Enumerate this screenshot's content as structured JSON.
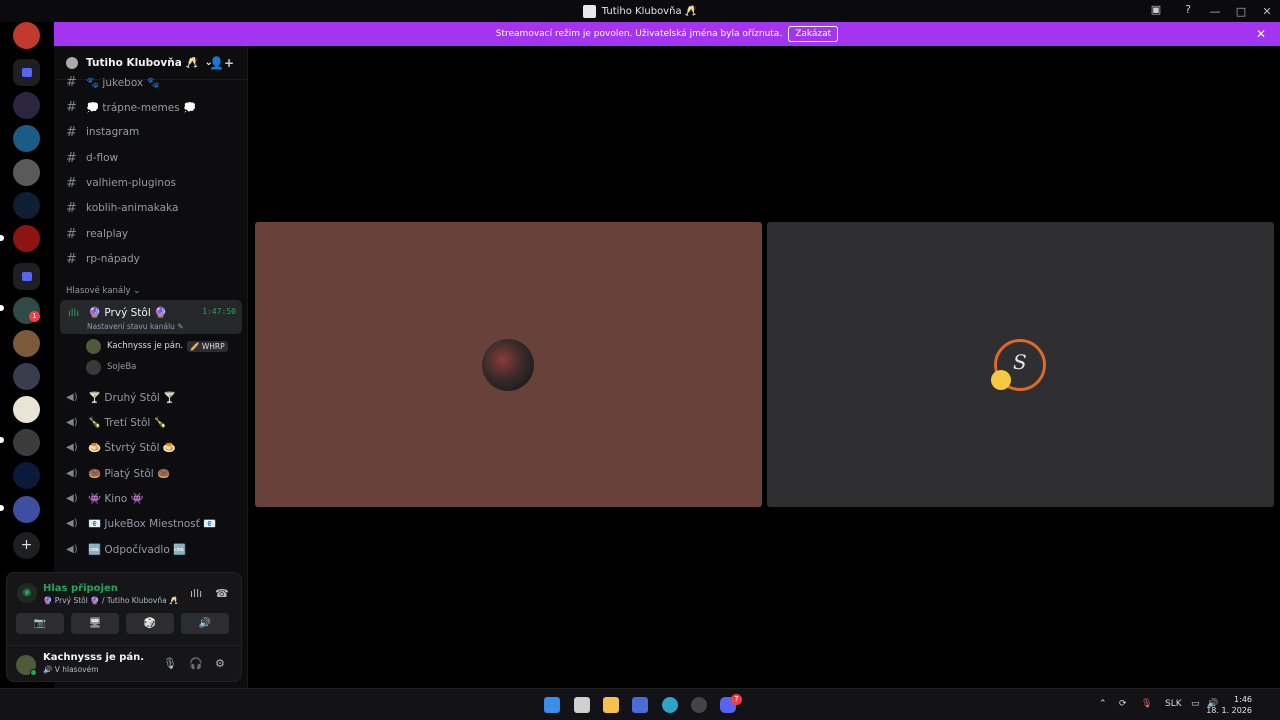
{
  "window": {
    "title": "Tutiho Klubovňa 🥂",
    "controls": [
      "—",
      "□",
      "✕"
    ]
  },
  "banner": {
    "text": "Streamovací režim je povolen. Uživatelská jména byla oříznuta.",
    "button": "Zakázat",
    "close": "✕"
  },
  "guild": {
    "name": "Tutiho Klubovňa 🥂",
    "chevron": "⌄",
    "invite_icon": "👤+"
  },
  "text_channels": [
    {
      "name": "🐾 jukebox 🐾"
    },
    {
      "name": "💭 trápne-memes 💭"
    },
    {
      "name": "instagram"
    },
    {
      "name": "d-flow"
    },
    {
      "name": "valhiem-pluginos"
    },
    {
      "name": "koblih-animakaka"
    },
    {
      "name": "realplay"
    },
    {
      "name": "rp-nápady"
    }
  ],
  "voice_category": "Hlasové kanály ⌄",
  "active_voice": {
    "name": "🔮 Prvý Stôl 🔮",
    "status": "Nastavení stavu kanálu ✎",
    "time": "1:47:50",
    "users": [
      {
        "name": "Kachnysss je pán.",
        "tag": "🥖 WHRP"
      },
      {
        "name": "SoJeBa",
        "tag": ""
      }
    ]
  },
  "voice_channels": [
    {
      "name": "🍸 Druhý Stôl 🍸"
    },
    {
      "name": "🍾 Tretí Stôl 🍾"
    },
    {
      "name": "🍮 Štvrtý Stôl 🍮"
    },
    {
      "name": "🍩 Piatý Stôl 🍩"
    },
    {
      "name": "👾 Kino 👾"
    },
    {
      "name": "📧 JukeBox Miestnosť 📧"
    },
    {
      "name": "🆒 Odpočívadlo 🆒"
    }
  ],
  "voice_panel": {
    "title": "Hlas připojen",
    "subtitle": "🔮 Prvý Stôl 🔮 / Tutiho Klubovňa 🥂",
    "buttons": [
      "📷",
      "🖥",
      "🎲",
      "🔊"
    ]
  },
  "user": {
    "name": "Kachnysss je pán.",
    "status": "🔊 V hlasovém"
  },
  "server_badge": "1",
  "taskbar": {
    "language": "SLK",
    "time": "1:46",
    "date": "18. 1. 2026",
    "discord_badge": "7"
  }
}
